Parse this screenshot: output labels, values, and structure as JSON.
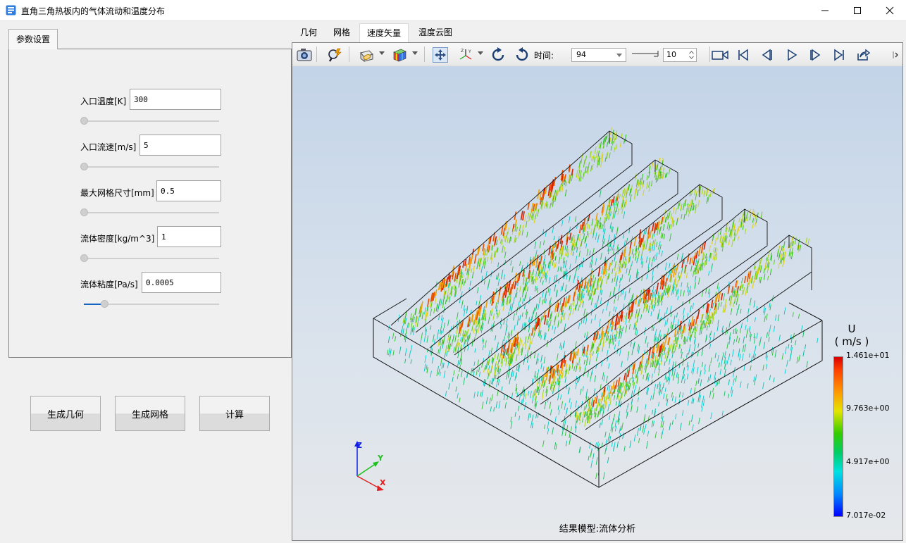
{
  "window": {
    "title": "直角三角热板内的气体流动和温度分布",
    "minimize_label": "—",
    "maximize_label": "☐",
    "close_label": "✕"
  },
  "left_panel": {
    "tab_label": "参数设置",
    "params": [
      {
        "label": "入口温度[K]",
        "value": "300",
        "slider_fraction": 0.0
      },
      {
        "label": "入口流速[m/s]",
        "value": "5",
        "slider_fraction": 0.0
      },
      {
        "label": "最大网格尺寸[mm]",
        "value": "0.5",
        "slider_fraction": 0.0
      },
      {
        "label": "流体密度[kg/m^3]",
        "value": "1",
        "slider_fraction": 0.0
      },
      {
        "label": "流体粘度[Pa/s]",
        "value": "0.0005",
        "slider_fraction": 0.16
      }
    ]
  },
  "actions": {
    "generate_geometry": "生成几何",
    "generate_mesh": "生成网格",
    "compute": "计算"
  },
  "view_tabs": [
    {
      "label": "几何",
      "active": false
    },
    {
      "label": "网格",
      "active": false
    },
    {
      "label": "速度矢量",
      "active": true
    },
    {
      "label": "温度云图",
      "active": false
    }
  ],
  "toolbar": {
    "icons": [
      "camera-icon",
      "zoom-probe-icon",
      "clip-plane-icon",
      "color-map-icon",
      "fit-view-icon",
      "axes-orient-icon",
      "rotate-cw-icon",
      "rotate-ccw-icon",
      "record-icon",
      "first-frame-icon",
      "prev-frame-icon",
      "play-icon",
      "next-frame-icon",
      "last-frame-icon",
      "export-icon"
    ],
    "time_label": "时间:",
    "time_value": "94",
    "step_value": "10"
  },
  "viewport": {
    "caption": "结果模型:流体分析",
    "legend": {
      "title_line1": "U",
      "title_line2": "( m/s )",
      "max": "1.461e+01",
      "v2": "9.763e+00",
      "v3": "4.917e+00",
      "min": "7.017e-02"
    },
    "axes": {
      "x": "X",
      "y": "Y",
      "z": "Z"
    }
  },
  "colors": {
    "accent": "#1565c0",
    "high_velocity": "#d80000",
    "low_velocity": "#00cccc"
  }
}
